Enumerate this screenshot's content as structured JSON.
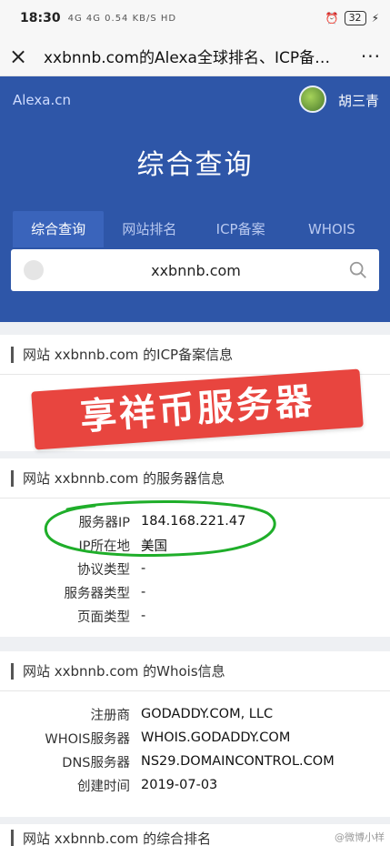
{
  "status": {
    "time": "18:30",
    "signal": "4G 4G 0.54 KB/S HD",
    "battery": "32"
  },
  "titlebar": {
    "close": "×",
    "title": "xxbnnb.com的Alexa全球排名、ICP备…",
    "more": "···"
  },
  "hero": {
    "brand": "Alexa.cn",
    "username": "胡三青",
    "title": "综合查询",
    "tabs": [
      "综合查询",
      "网站排名",
      "ICP备案",
      "WHOIS"
    ],
    "search_value": "xxbnnb.com"
  },
  "icp_section": {
    "title": "网站 xxbnnb.com 的ICP备案信息"
  },
  "stamp_text": "享祥币服务器",
  "server_section": {
    "title": "网站 xxbnnb.com 的服务器信息",
    "rows": [
      {
        "k": "服务器IP",
        "v": "184.168.221.47"
      },
      {
        "k": "IP所在地",
        "v": "美国"
      },
      {
        "k": "协议类型",
        "v": "-"
      },
      {
        "k": "服务器类型",
        "v": "-"
      },
      {
        "k": "页面类型",
        "v": "-"
      }
    ]
  },
  "whois_section": {
    "title": "网站 xxbnnb.com 的Whois信息",
    "rows": [
      {
        "k": "注册商",
        "v": "GODADDY.COM, LLC"
      },
      {
        "k": "WHOIS服务器",
        "v": "WHOIS.GODADDY.COM"
      },
      {
        "k": "DNS服务器",
        "v": "NS29.DOMAINCONTROL.COM"
      },
      {
        "k": "创建时间",
        "v": "2019-07-03"
      }
    ]
  },
  "rank_section": {
    "title": "网站 xxbnnb.com 的综合排名"
  },
  "watermark": "@微博小样"
}
